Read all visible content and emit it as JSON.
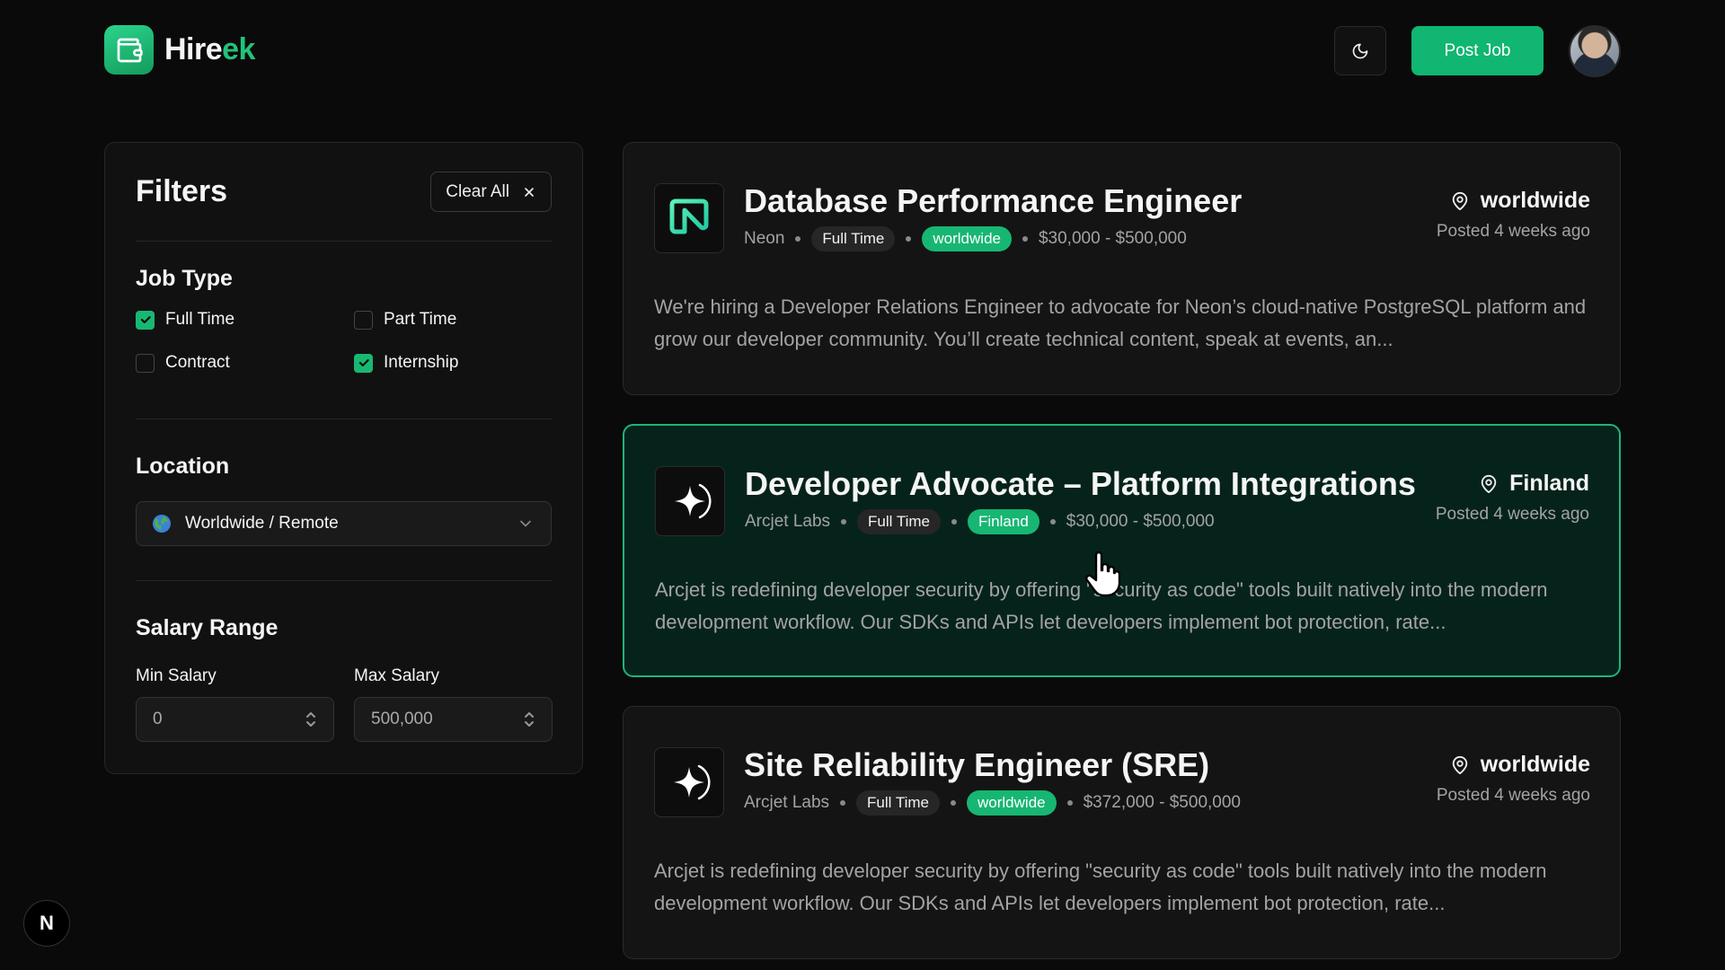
{
  "header": {
    "logo_main": "Hire",
    "logo_accent": "ek",
    "post_job_label": "Post Job"
  },
  "filters": {
    "title": "Filters",
    "clear_label": "Clear All",
    "job_type": {
      "heading": "Job Type",
      "options": [
        {
          "label": "Full Time",
          "checked": true
        },
        {
          "label": "Part Time",
          "checked": false
        },
        {
          "label": "Contract",
          "checked": false
        },
        {
          "label": "Internship",
          "checked": true
        }
      ]
    },
    "location": {
      "heading": "Location",
      "selected": "Worldwide / Remote"
    },
    "salary": {
      "heading": "Salary Range",
      "min_label": "Min Salary",
      "min_value": "0",
      "max_label": "Max Salary",
      "max_value": "500,000"
    }
  },
  "jobs": [
    {
      "title": "Database Performance Engineer",
      "company": "Neon",
      "type": "Full Time",
      "region": "worldwide",
      "salary": "$30,000 - $500,000",
      "location": "worldwide",
      "posted": "Posted 4 weeks ago",
      "description": "We're hiring a Developer Relations Engineer to advocate for Neon’s cloud-native PostgreSQL platform and grow our developer community. You’ll create technical content, speak at events, an...",
      "logo": "neon-logo-icon"
    },
    {
      "title": "Developer Advocate – Platform Integrations",
      "company": "Arcjet Labs",
      "type": "Full Time",
      "region": "Finland",
      "salary": "$30,000 - $500,000",
      "location": "Finland",
      "posted": "Posted 4 weeks ago",
      "description": "Arcjet is redefining developer security by offering \"security as code\" tools built natively into the modern development workflow. Our SDKs and APIs let developers implement bot protection, rate...",
      "logo": "arcjet-logo-icon"
    },
    {
      "title": "Site Reliability Engineer (SRE)",
      "company": "Arcjet Labs",
      "type": "Full Time",
      "region": "worldwide",
      "salary": "$372,000 - $500,000",
      "location": "worldwide",
      "posted": "Posted 4 weeks ago",
      "description": "Arcjet is redefining developer security by offering \"security as code\" tools built natively into the modern development workflow. Our SDKs and APIs let developers implement bot protection, rate...",
      "logo": "arcjet-logo-icon"
    }
  ],
  "colors": {
    "accent": "#10b672",
    "background": "#0a0a0a",
    "active_card": "#06231b"
  },
  "dev_badge": "N"
}
